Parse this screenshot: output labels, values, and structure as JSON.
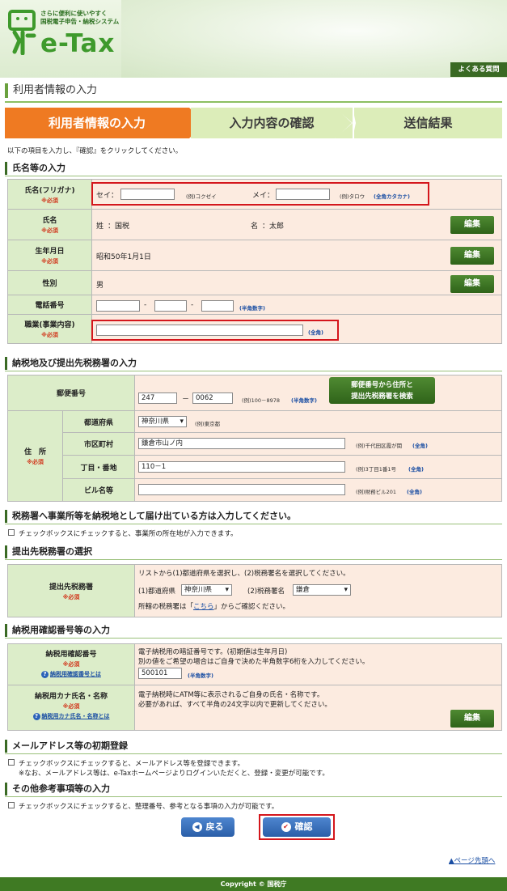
{
  "header": {
    "tagline_1": "さらに便利に使いやすく",
    "tagline_2": "国税電子申告・納税システム",
    "logo": "e-Tax",
    "faq_label": "よくある質問"
  },
  "page_title": "利用者情報の入力",
  "steps": [
    "利用者情報の入力",
    "入力内容の確認",
    "送信結果"
  ],
  "intro": "以下の項目を入力し、『確認』をクリックしてください。",
  "required_mark": "※必須",
  "edit_label": "編集",
  "section_name": {
    "heading": "氏名等の入力",
    "furigana_label": "氏名(フリガナ)",
    "sei_label": "セイ：",
    "sei_value": "",
    "sei_example": "(例)コクゼイ",
    "mei_label": "メイ：",
    "mei_value": "",
    "mei_example": "(例)タロウ",
    "kana_note": "(全角カタカナ)",
    "name_label": "氏名",
    "surname_label": "姓",
    "surname_value": "：国税",
    "given_label": "名",
    "given_value": "：太郎",
    "birth_label": "生年月日",
    "birth_value": "昭和50年1月1日",
    "gender_label": "性別",
    "gender_value": "男",
    "phone_label": "電話番号",
    "phone_1": "",
    "phone_2": "",
    "phone_3": "",
    "dash": "-",
    "phone_note": "(半角数字)",
    "job_label": "職業(事業内容)",
    "job_value": "",
    "job_note": "(全角)"
  },
  "section_address": {
    "heading": "納税地及び提出先税務署の入力",
    "zip_label": "郵便番号",
    "zip_1": "247",
    "zip_sep": "－",
    "zip_2": "0062",
    "zip_example": "(例)100－8978",
    "zip_note": "(半角数字)",
    "zip_search_1": "郵便番号から住所と",
    "zip_search_2": "提出先税務署を検索",
    "address_label": "住　所",
    "pref_label": "都道府県",
    "pref_value": "神奈川県",
    "pref_example": "(例)東京都",
    "city_label": "市区町村",
    "city_value": "鎌倉市山ノ内",
    "city_example": "(例)千代田区霞が関",
    "city_note": "(全角)",
    "block_label": "丁目・番地",
    "block_value": "110－1",
    "block_example": "(例)3丁目1番1号",
    "block_note": "(全角)",
    "bldg_label": "ビル名等",
    "bldg_value": "",
    "bldg_example": "(例)財務ビル201",
    "bldg_note": "(全角)"
  },
  "section_office_notice": {
    "heading": "税務署へ事業所等を納税地として届け出ている方は入力してください。",
    "checkbox_text": "チェックボックスにチェックすると、事業所の所在地が入力できます。"
  },
  "section_taxoffice": {
    "heading": "提出先税務署の選択",
    "label": "提出先税務署",
    "instruction": "リストから(1)都道府県を選択し、(2)税務署名を選択してください。",
    "pref_label": "(1)都道府県",
    "pref_value": "神奈川県",
    "office_label": "(2)税務署名",
    "office_value": "鎌倉",
    "confirm_pre": "所轄の税務署は「",
    "confirm_link": "こちら",
    "confirm_post": "」からご確認ください。"
  },
  "section_pin": {
    "heading": "納税用確認番号等の入力",
    "pin_label": "納税用確認番号",
    "pin_help": "納税用確認番号とは",
    "pin_text_1": "電子納税用の暗証番号です。(初期値は生年月日)",
    "pin_text_2": "別の値をご希望の場合はご自身で決めた半角数字6桁を入力してください。",
    "pin_value": "500101",
    "pin_note": "(半角数字)",
    "kana_label": "納税用カナ氏名・名称",
    "kana_help": "納税用カナ氏名・名称とは",
    "kana_text_1": "電子納税時にATM等に表示されるご自身の氏名・名称です。",
    "kana_text_2": "必要があれば、すべて半角の24文字以内で更新してください。"
  },
  "section_email": {
    "heading": "メールアドレス等の初期登録",
    "checkbox_text": "チェックボックスにチェックすると、メールアドレス等を登録できます。",
    "note": "※なお、メールアドレス等は、e-Taxホームページよりログインいただくと、登録・変更が可能です。"
  },
  "section_other": {
    "heading": "その他参考事項等の入力",
    "checkbox_text": "チェックボックスにチェックすると、整理番号、参考となる事項の入力が可能です。"
  },
  "buttons": {
    "back": "戻る",
    "confirm": "確認"
  },
  "page_top": "ページ先頭へ",
  "footer": "Copyright © 国税庁"
}
